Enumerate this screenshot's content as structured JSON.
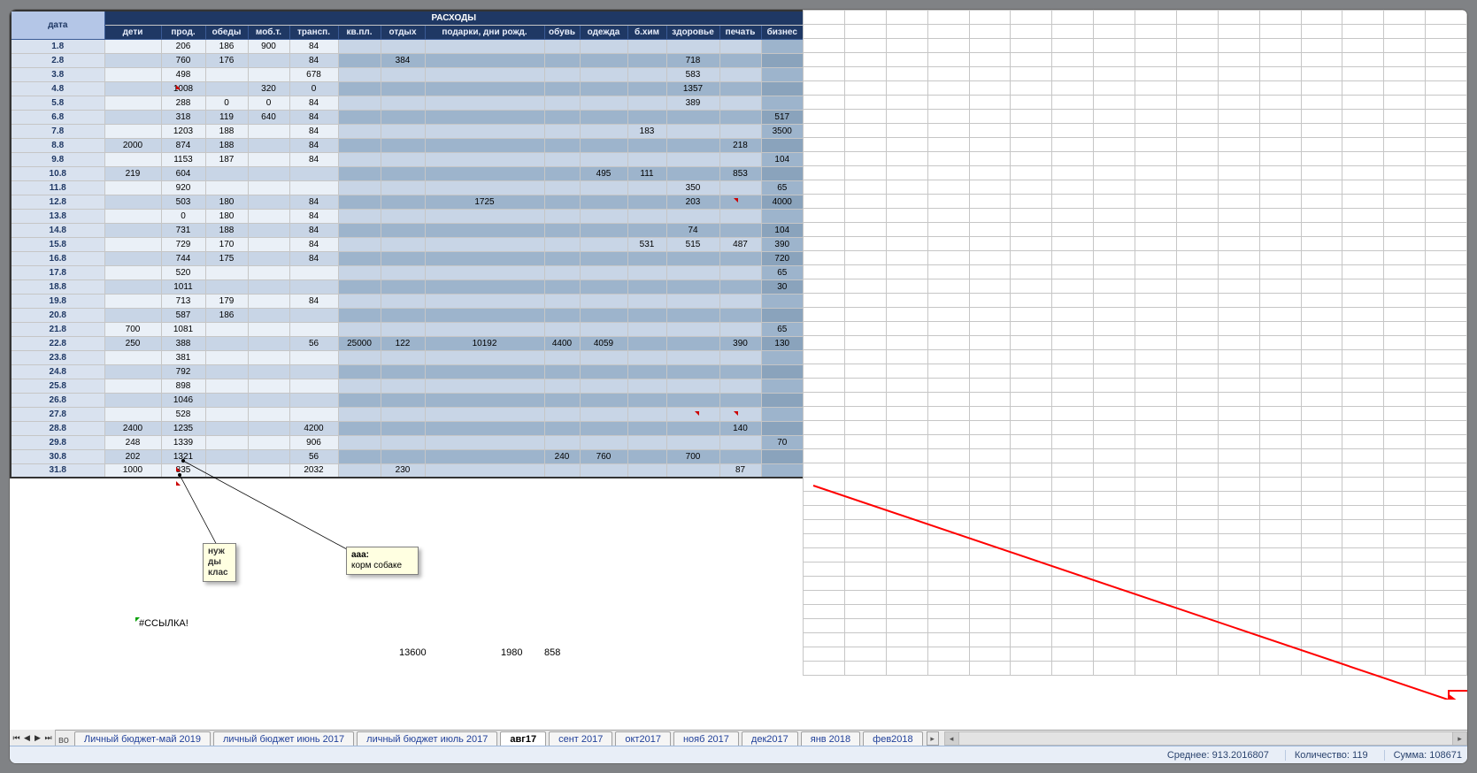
{
  "header": {
    "title": "РАСХОДЫ",
    "date_col": "дата",
    "cols": [
      "дети",
      "прод.",
      "обеды",
      "моб.т.",
      "трансп.",
      "кв.пл.",
      "отдых",
      "подарки, дни рожд.",
      "обувь",
      "одежда",
      "б.хим",
      "здоровье",
      "печать",
      "бизнес"
    ]
  },
  "rows": [
    {
      "date": "1.8",
      "style": "A",
      "c": [
        "",
        "206",
        "186",
        "900",
        "84",
        "",
        "",
        "",
        "",
        "",
        "",
        "",
        "",
        ""
      ]
    },
    {
      "date": "2.8",
      "style": "B",
      "c": [
        "",
        "760",
        "176",
        "",
        "84",
        "",
        "384",
        "",
        "",
        "",
        "",
        "718",
        "",
        ""
      ]
    },
    {
      "date": "3.8",
      "style": "A",
      "c": [
        "",
        "498",
        "",
        "",
        "678",
        "",
        "",
        "",
        "",
        "",
        "",
        "583",
        "",
        ""
      ]
    },
    {
      "date": "4.8",
      "style": "B",
      "c": [
        "",
        "1008",
        "",
        "320",
        "0",
        "",
        "",
        "",
        "",
        "",
        "",
        "1357",
        "",
        ""
      ]
    },
    {
      "date": "5.8",
      "style": "A",
      "c": [
        "",
        "288",
        "0",
        "0",
        "84",
        "",
        "",
        "",
        "",
        "",
        "",
        "389",
        "",
        ""
      ]
    },
    {
      "date": "6.8",
      "style": "B",
      "c": [
        "",
        "318",
        "119",
        "640",
        "84",
        "",
        "",
        "",
        "",
        "",
        "",
        "",
        "",
        "517"
      ]
    },
    {
      "date": "7.8",
      "style": "A",
      "c": [
        "",
        "1203",
        "188",
        "",
        "84",
        "",
        "",
        "",
        "",
        "",
        "183",
        "",
        "",
        "3500"
      ]
    },
    {
      "date": "8.8",
      "style": "B",
      "c": [
        "2000",
        "874",
        "188",
        "",
        "84",
        "",
        "",
        "",
        "",
        "",
        "",
        "",
        "218",
        ""
      ]
    },
    {
      "date": "9.8",
      "style": "A",
      "c": [
        "",
        "1153",
        "187",
        "",
        "84",
        "",
        "",
        "",
        "",
        "",
        "",
        "",
        "",
        "104"
      ]
    },
    {
      "date": "10.8",
      "style": "B",
      "c": [
        "219",
        "604",
        "",
        "",
        "",
        "",
        "",
        "",
        "",
        "495",
        "111",
        "",
        "853",
        ""
      ]
    },
    {
      "date": "11.8",
      "style": "A",
      "c": [
        "",
        "920",
        "",
        "",
        "",
        "",
        "",
        "",
        "",
        "",
        "",
        "350",
        "",
        "65"
      ]
    },
    {
      "date": "12.8",
      "style": "B",
      "c": [
        "",
        "503",
        "180",
        "",
        "84",
        "",
        "",
        "1725",
        "",
        "",
        "",
        "203",
        "",
        "4000"
      ]
    },
    {
      "date": "13.8",
      "style": "A",
      "c": [
        "",
        "0",
        "180",
        "",
        "84",
        "",
        "",
        "",
        "",
        "",
        "",
        "",
        "",
        ""
      ]
    },
    {
      "date": "14.8",
      "style": "B",
      "c": [
        "",
        "731",
        "188",
        "",
        "84",
        "",
        "",
        "",
        "",
        "",
        "",
        "74",
        "",
        "104"
      ]
    },
    {
      "date": "15.8",
      "style": "A",
      "c": [
        "",
        "729",
        "170",
        "",
        "84",
        "",
        "",
        "",
        "",
        "",
        "531",
        "515",
        "487",
        "390"
      ]
    },
    {
      "date": "16.8",
      "style": "B",
      "c": [
        "",
        "744",
        "175",
        "",
        "84",
        "",
        "",
        "",
        "",
        "",
        "",
        "",
        "",
        "720"
      ]
    },
    {
      "date": "17.8",
      "style": "A",
      "c": [
        "",
        "520",
        "",
        "",
        "",
        "",
        "",
        "",
        "",
        "",
        "",
        "",
        "",
        "65"
      ]
    },
    {
      "date": "18.8",
      "style": "B",
      "c": [
        "",
        "1011",
        "",
        "",
        "",
        "",
        "",
        "",
        "",
        "",
        "",
        "",
        "",
        "30"
      ]
    },
    {
      "date": "19.8",
      "style": "A",
      "c": [
        "",
        "713",
        "179",
        "",
        "84",
        "",
        "",
        "",
        "",
        "",
        "",
        "",
        "",
        ""
      ]
    },
    {
      "date": "20.8",
      "style": "B",
      "c": [
        "",
        "587",
        "186",
        "",
        "",
        "",
        "",
        "",
        "",
        "",
        "",
        "",
        "",
        ""
      ]
    },
    {
      "date": "21.8",
      "style": "A",
      "c": [
        "700",
        "1081",
        "",
        "",
        "",
        "",
        "",
        "",
        "",
        "",
        "",
        "",
        "",
        "65"
      ]
    },
    {
      "date": "22.8",
      "style": "B",
      "c": [
        "250",
        "388",
        "",
        "",
        "56",
        "25000",
        "122",
        "10192",
        "4400",
        "4059",
        "",
        "",
        "390",
        "130"
      ]
    },
    {
      "date": "23.8",
      "style": "A",
      "c": [
        "",
        "381",
        "",
        "",
        "",
        "",
        "",
        "",
        "",
        "",
        "",
        "",
        "",
        ""
      ]
    },
    {
      "date": "24.8",
      "style": "B",
      "c": [
        "",
        "792",
        "",
        "",
        "",
        "",
        "",
        "",
        "",
        "",
        "",
        "",
        "",
        ""
      ]
    },
    {
      "date": "25.8",
      "style": "A",
      "c": [
        "",
        "898",
        "",
        "",
        "",
        "",
        "",
        "",
        "",
        "",
        "",
        "",
        "",
        ""
      ]
    },
    {
      "date": "26.8",
      "style": "B",
      "c": [
        "",
        "1046",
        "",
        "",
        "",
        "",
        "",
        "",
        "",
        "",
        "",
        "",
        "",
        ""
      ]
    },
    {
      "date": "27.8",
      "style": "A",
      "c": [
        "",
        "528",
        "",
        "",
        "",
        "",
        "",
        "",
        "",
        "",
        "",
        "",
        "",
        ""
      ]
    },
    {
      "date": "28.8",
      "style": "B",
      "c": [
        "2400",
        "1235",
        "",
        "",
        "4200",
        "",
        "",
        "",
        "",
        "",
        "",
        "",
        "140",
        ""
      ]
    },
    {
      "date": "29.8",
      "style": "A",
      "c": [
        "248",
        "1339",
        "",
        "",
        "906",
        "",
        "",
        "",
        "",
        "",
        "",
        "",
        "",
        "70"
      ]
    },
    {
      "date": "30.8",
      "style": "B",
      "c": [
        "202",
        "1321",
        "",
        "",
        "56",
        "",
        "",
        "",
        "240",
        "760",
        "",
        "700",
        "",
        ""
      ]
    },
    {
      "date": "31.8",
      "style": "A",
      "c": [
        "1000",
        "835",
        "",
        "",
        "2032",
        "",
        "230",
        "",
        "",
        "",
        "",
        "",
        "87",
        ""
      ]
    }
  ],
  "col_style_A": [
    "cell-light",
    "cell-light",
    "cell-light",
    "cell-light",
    "cell-light",
    "cell-med",
    "cell-med",
    "cell-med",
    "cell-med",
    "cell-med",
    "cell-med",
    "cell-med",
    "cell-med",
    "cell-dark"
  ],
  "col_style_B": [
    "cell-med",
    "cell-med",
    "cell-med",
    "cell-med",
    "cell-med",
    "cell-dark",
    "cell-dark",
    "cell-dark",
    "cell-dark",
    "cell-dark",
    "cell-dark",
    "cell-dark",
    "cell-dark",
    "cell-vdark"
  ],
  "notes": {
    "n1": "нуж\nды\nклас",
    "n2_h": "aaa:",
    "n2_b": "корм собаке"
  },
  "ref_error": "#ССЫЛКА!",
  "figs": {
    "f1": "13600",
    "f2": "1980",
    "f3": "858"
  },
  "tabs": {
    "prefix_label": "во",
    "items": [
      "Личный бюджет-май 2019",
      "личный бюджет июнь 2017",
      "личный бюджет  июль 2017",
      "авг17",
      "сент 2017",
      "окт2017",
      "нояб 2017",
      "дек2017",
      "янв 2018",
      "фев2018"
    ],
    "active_index": 3
  },
  "statusbar": {
    "avg_label": "Среднее:",
    "avg_value": "913.2016807",
    "count_label": "Количество:",
    "count_value": "119",
    "sum_label": "Сумма:",
    "sum_value": "108671"
  }
}
